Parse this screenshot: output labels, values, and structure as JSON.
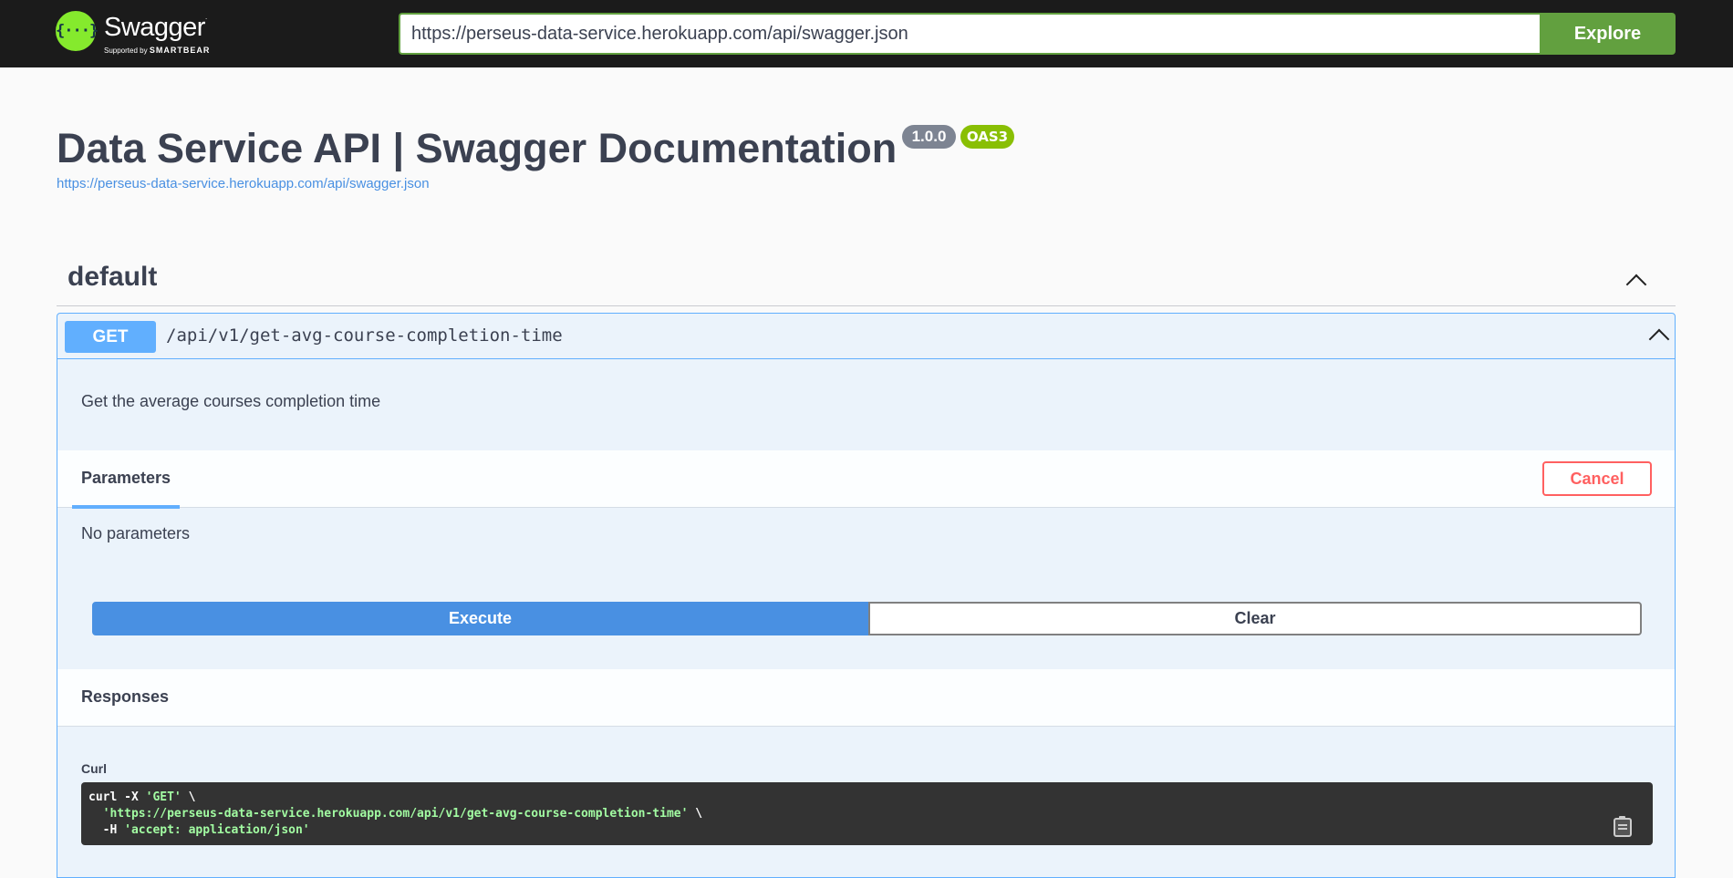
{
  "topbar": {
    "logo": {
      "icon": "{···}",
      "name": "Swagger",
      "supported_by": "Supported by",
      "brand": "SMARTBEAR"
    },
    "url_value": "https://perseus-data-service.herokuapp.com/api/swagger.json",
    "explore_label": "Explore"
  },
  "info": {
    "title": "Data Service API | Swagger Documentation",
    "version": "1.0.0",
    "oas": "OAS3",
    "spec_url": "https://perseus-data-service.herokuapp.com/api/swagger.json"
  },
  "tag": {
    "name": "default"
  },
  "operation": {
    "method": "GET",
    "path": "/api/v1/get-avg-course-completion-time",
    "description": "Get the average courses completion time",
    "parameters_tab": "Parameters",
    "cancel_label": "Cancel",
    "no_parameters": "No parameters",
    "execute_label": "Execute",
    "clear_label": "Clear",
    "responses_title": "Responses",
    "curl_label": "Curl",
    "curl": {
      "line1_cmd": "curl -X ",
      "line1_method": "'GET'",
      "line1_end": " \\",
      "line2_url": "'https://perseus-data-service.herokuapp.com/api/v1/get-avg-course-completion-time'",
      "line2_end": " \\",
      "line3_flag": "  -H ",
      "line3_header": "'accept: application/json'"
    }
  },
  "colors": {
    "topbar": "#1b1b1b",
    "explore": "#62a03f",
    "get": "#61affe",
    "execute": "#4990e2",
    "cancel": "#ff6060",
    "oas": "#89bf04",
    "version": "#7d8492"
  }
}
